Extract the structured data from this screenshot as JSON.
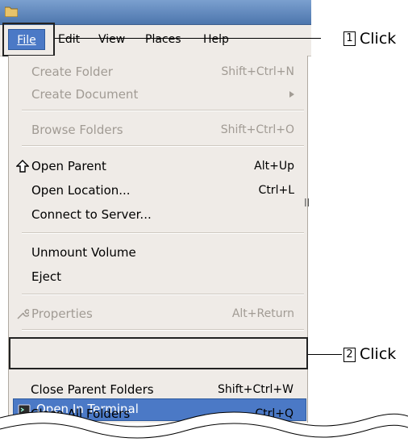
{
  "menubar": {
    "file": "File",
    "edit": "Edit",
    "view": "View",
    "places": "Places",
    "help": "Help"
  },
  "menu": {
    "create_folder": {
      "label": "Create Folder",
      "accel": "Shift+Ctrl+N"
    },
    "create_document": {
      "label": "Create Document"
    },
    "browse_folders": {
      "label": "Browse Folders",
      "accel": "Shift+Ctrl+O"
    },
    "open_parent": {
      "label": "Open Parent",
      "accel": "Alt+Up"
    },
    "open_location": {
      "label": "Open Location...",
      "accel": "Ctrl+L"
    },
    "connect_server": {
      "label": "Connect to Server..."
    },
    "unmount": {
      "label": "Unmount Volume"
    },
    "eject": {
      "label": "Eject"
    },
    "properties": {
      "label": "Properties",
      "accel": "Alt+Return"
    },
    "open_terminal": {
      "label": "Open In Terminal"
    },
    "close_parent": {
      "label": "Close Parent Folders",
      "accel": "Shift+Ctrl+W"
    },
    "close_all": {
      "label": "Close All Folders",
      "accel": "Ctrl+Q"
    }
  },
  "callouts": [
    {
      "num": "1",
      "text": "Click"
    },
    {
      "num": "2",
      "text": "Click"
    }
  ],
  "stray_text": "ll",
  "colors": {
    "highlight": "#4b79c6",
    "menu_bg": "#efebe7",
    "disabled": "#a19b94"
  }
}
